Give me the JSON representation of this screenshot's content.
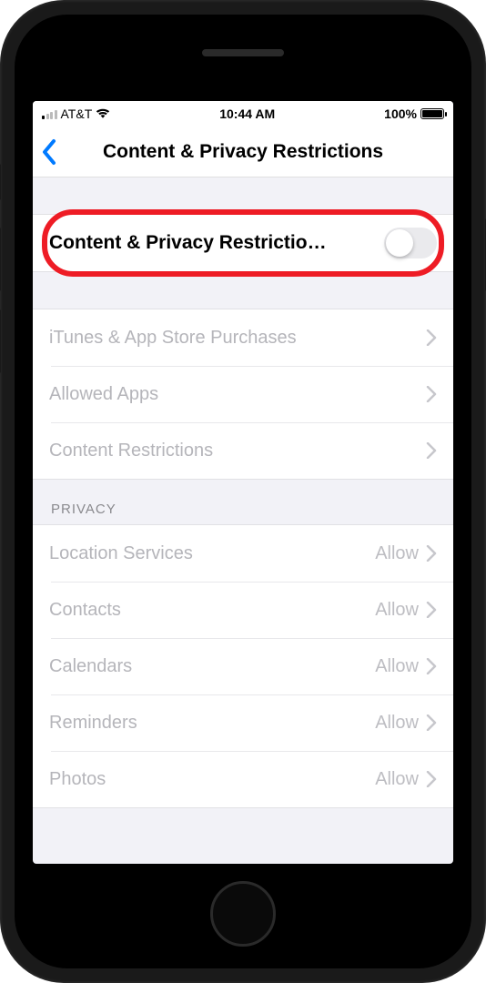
{
  "status": {
    "carrier": "AT&T",
    "time": "10:44 AM",
    "battery": "100%"
  },
  "nav": {
    "title": "Content & Privacy Restrictions"
  },
  "toggle_row": {
    "label": "Content & Privacy Restrictio…",
    "on": false
  },
  "group1": {
    "itunes": "iTunes & App Store Purchases",
    "allowed_apps": "Allowed Apps",
    "content_restrictions": "Content Restrictions"
  },
  "privacy": {
    "header": "PRIVACY",
    "location": {
      "label": "Location Services",
      "value": "Allow"
    },
    "contacts": {
      "label": "Contacts",
      "value": "Allow"
    },
    "calendars": {
      "label": "Calendars",
      "value": "Allow"
    },
    "reminders": {
      "label": "Reminders",
      "value": "Allow"
    },
    "photos": {
      "label": "Photos",
      "value": "Allow"
    }
  }
}
